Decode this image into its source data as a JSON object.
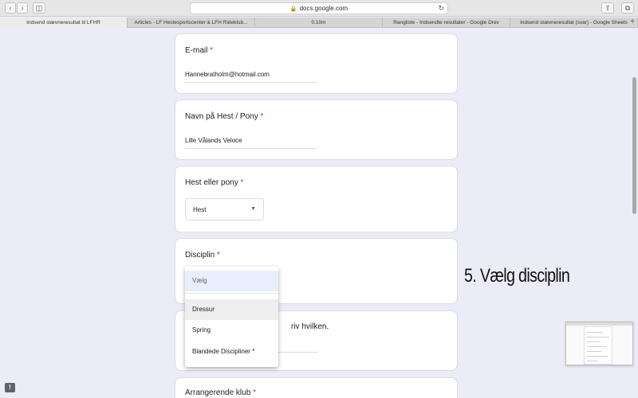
{
  "browser": {
    "url": "docs.google.com",
    "tabs": [
      "Indsend stævneresultat til LFHR",
      "Articles - LF Hestesportscenter & LFH Rideklub...",
      "0.10m",
      "Rangliste - Indsendte resultater - Google Drev",
      "Indsend stævneresultat (svar) - Google Sheets"
    ],
    "new_tab_label": "+"
  },
  "form": {
    "email": {
      "label": "E-mail",
      "required": "*",
      "value": "Hannebratholm@hotmail.com"
    },
    "horse_name": {
      "label": "Navn på Hest / Pony",
      "required": "*",
      "value": "Lille Vålands Veloce"
    },
    "horse_or_pony": {
      "label": "Hest eller pony",
      "required": "*",
      "value": "Hest"
    },
    "discipline": {
      "label": "Disciplin",
      "required": "*",
      "placeholder": "Vælg",
      "options": [
        "Dressur",
        "Spring",
        "Blandede Discipliner *"
      ],
      "hovered_option": "Dressur"
    },
    "next_question_fragment": "riv hvilken.",
    "organizer": {
      "label": "Arrangerende klub",
      "required": "*"
    }
  },
  "overlay": {
    "caption": "5. Vælg disciplin"
  },
  "feedback_label": "!"
}
